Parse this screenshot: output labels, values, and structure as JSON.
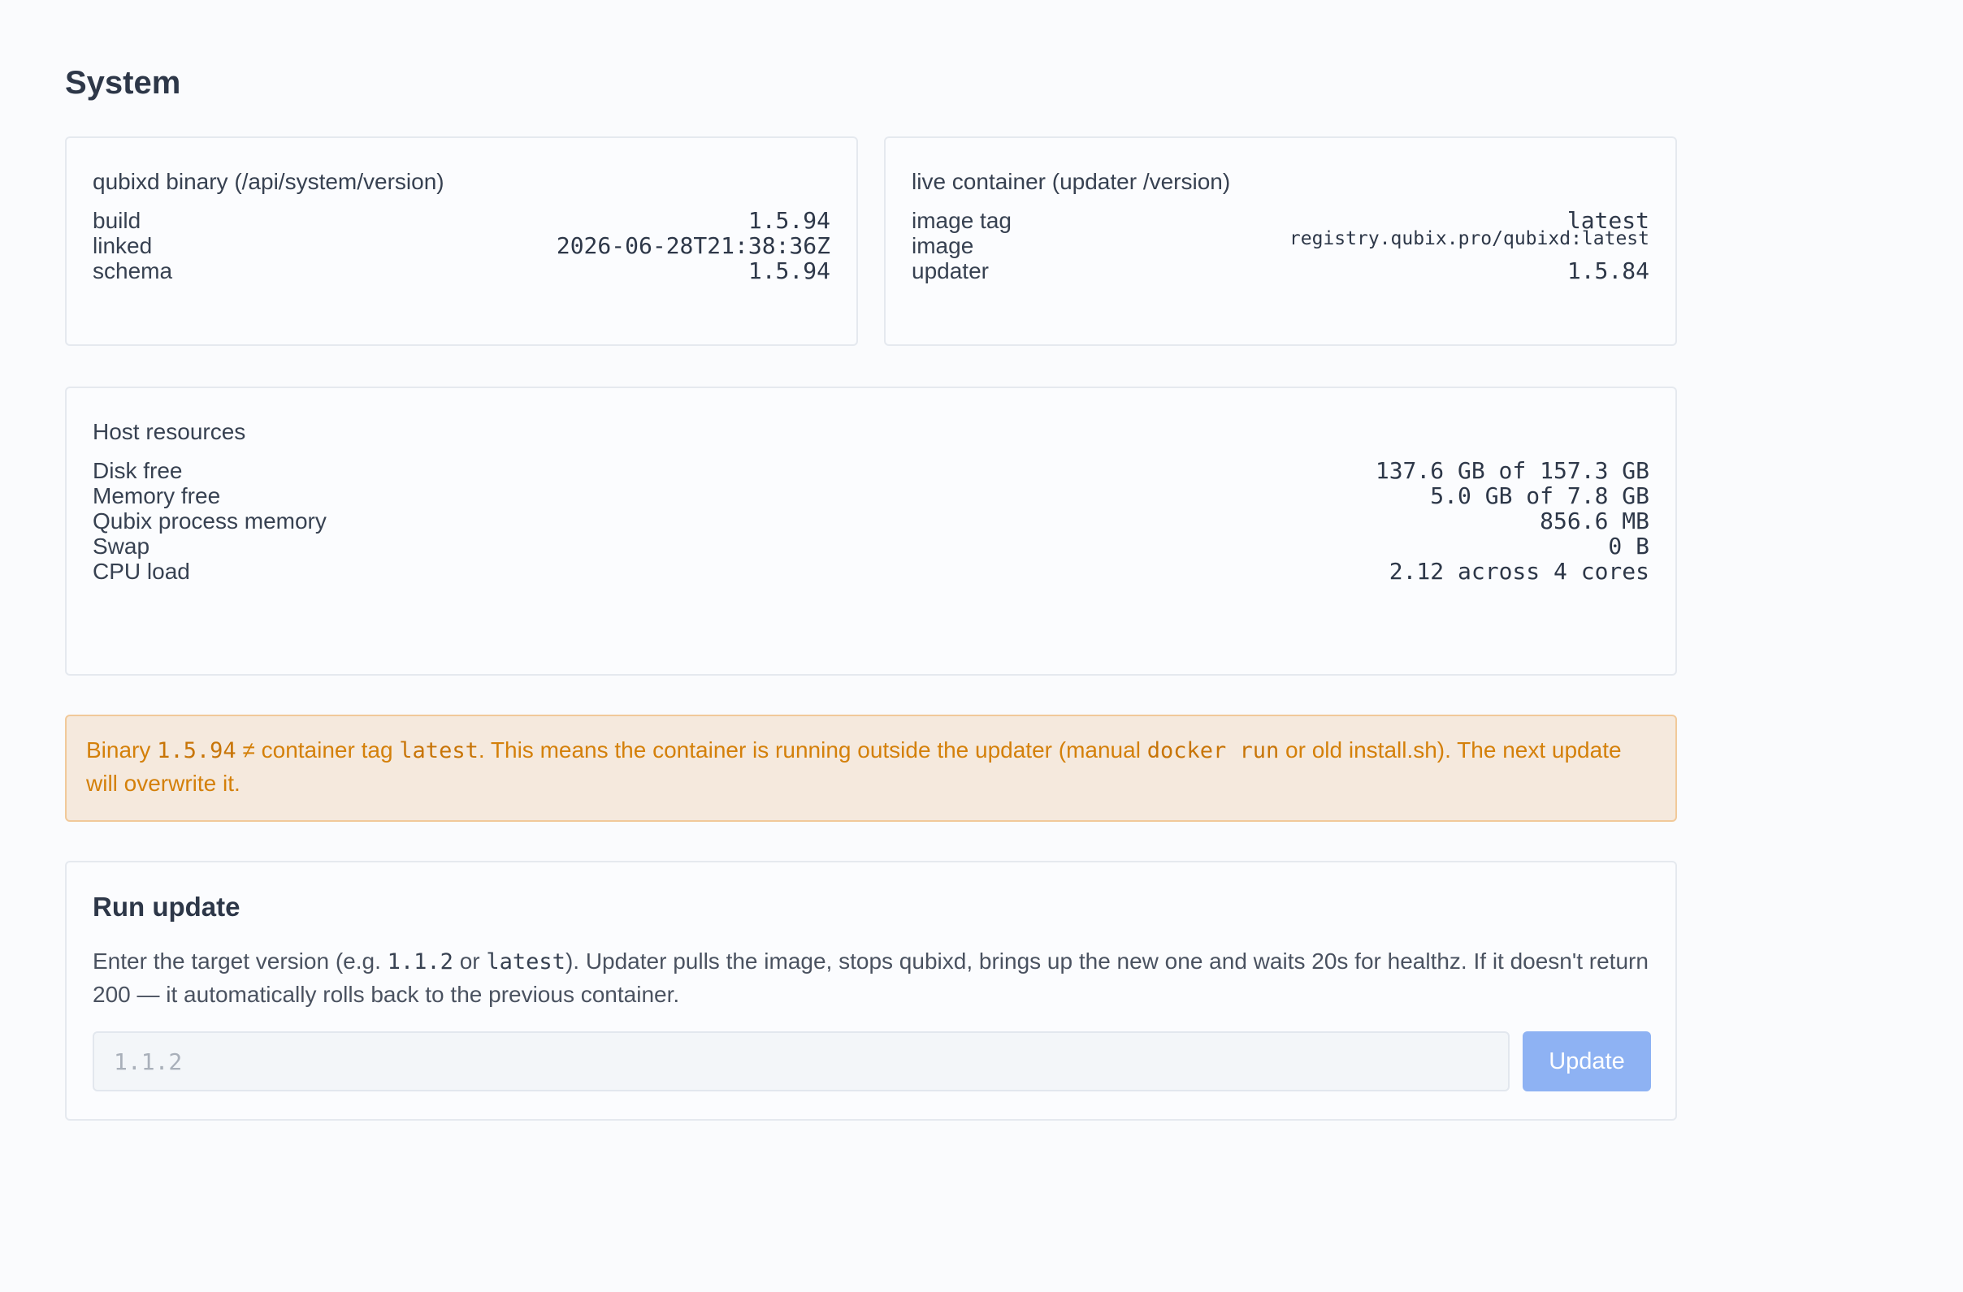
{
  "page": {
    "title": "System"
  },
  "binary": {
    "title": "qubixd binary (/api/system/version)",
    "rows": [
      {
        "label": "build",
        "value": "1.5.94"
      },
      {
        "label": "linked",
        "value": "2026-06-28T21:38:36Z"
      },
      {
        "label": "schema",
        "value": "1.5.94"
      }
    ]
  },
  "container": {
    "title": "live container (updater /version)",
    "rows": [
      {
        "label": "image tag",
        "value": "latest"
      },
      {
        "label": "image",
        "value": "registry.qubix.pro/qubixd:latest"
      },
      {
        "label": "updater",
        "value": "1.5.84"
      }
    ]
  },
  "host": {
    "title": "Host resources",
    "rows": [
      {
        "label": "Disk free",
        "value": "137.6 GB of 157.3 GB"
      },
      {
        "label": "Memory free",
        "value": "5.0 GB of 7.8 GB"
      },
      {
        "label": "Qubix process memory",
        "value": "856.6 MB"
      },
      {
        "label": "Swap",
        "value": "0 B"
      },
      {
        "label": "CPU load",
        "value": "2.12 across 4 cores"
      }
    ]
  },
  "alert": {
    "t1": "Binary ",
    "c1": "1.5.94",
    "t2": " ≠ container tag ",
    "c2": "latest",
    "t3": ". This means the container is running outside the updater (manual ",
    "c3": "docker run",
    "t4": " or old install.sh). The next update will overwrite it."
  },
  "update": {
    "title": "Run update",
    "desc_t1": "Enter the target version (e.g. ",
    "desc_c1": "1.1.2",
    "desc_t2": " or ",
    "desc_c2": "latest",
    "desc_t3": "). Updater pulls the image, stops qubixd, brings up the new one and waits 20s for healthz. If it doesn't return 200 — it automatically rolls back to the previous container.",
    "input_value": "",
    "input_placeholder": "1.1.2",
    "button_label": "Update"
  },
  "colors": {
    "alert_bg": "#f5e9dd",
    "alert_text": "#d4800a",
    "button_bg": "#8eb2f3"
  }
}
